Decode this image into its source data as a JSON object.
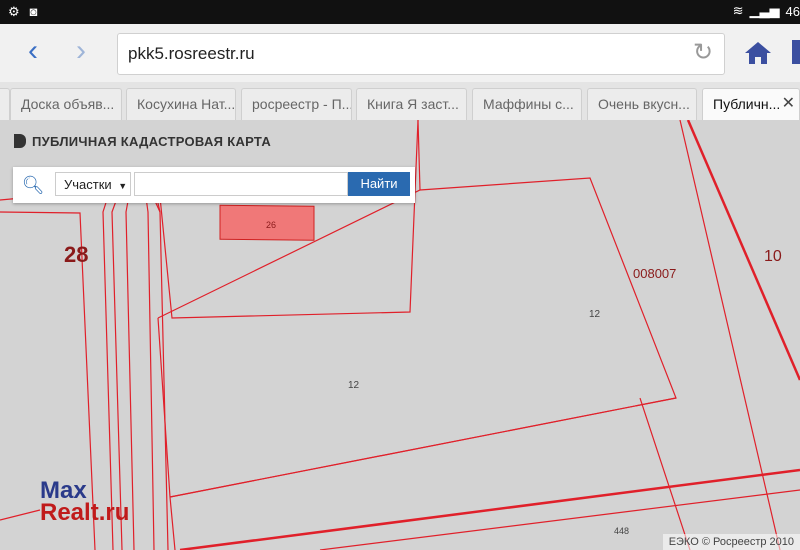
{
  "statusbar": {
    "network": "46"
  },
  "toolbar": {
    "back_icon": "back-arrow-icon",
    "forward_icon": "forward-arrow-icon",
    "url": "pkk5.rosreestr.ru",
    "reload_icon": "reload-icon",
    "home_icon": "home-icon",
    "colors": {
      "nav": "#3b6fc4",
      "bookmark": "#3b4fa0"
    }
  },
  "tabs": [
    {
      "label": "Доска объяв..."
    },
    {
      "label": "Косухина Нат..."
    },
    {
      "label": "росреестр - П..."
    },
    {
      "label": "Книга Я заст..."
    },
    {
      "label": "Маффины с..."
    },
    {
      "label": "Очень вкусн..."
    },
    {
      "label": "Публичн...",
      "active": true
    }
  ],
  "map": {
    "title": "ПУБЛИЧНАЯ КАДАСТРОВАЯ КАРТА",
    "search": {
      "type_selected": "Участки",
      "button": "Найти",
      "query": ""
    },
    "labels": {
      "highlighted_parcel": "26",
      "block_28": "28",
      "block_008007": "008007",
      "block_10": "10",
      "parcel_12a": "12",
      "parcel_12b": "12",
      "parcel_448": "448"
    },
    "colors": {
      "parcel_line": "#e0202a",
      "highlighted_parcel": "#f07878"
    },
    "attribution": "ЕЭКО © Росреестр 2010"
  },
  "watermark": {
    "line1": "Max",
    "line2": "Realt.ru"
  }
}
